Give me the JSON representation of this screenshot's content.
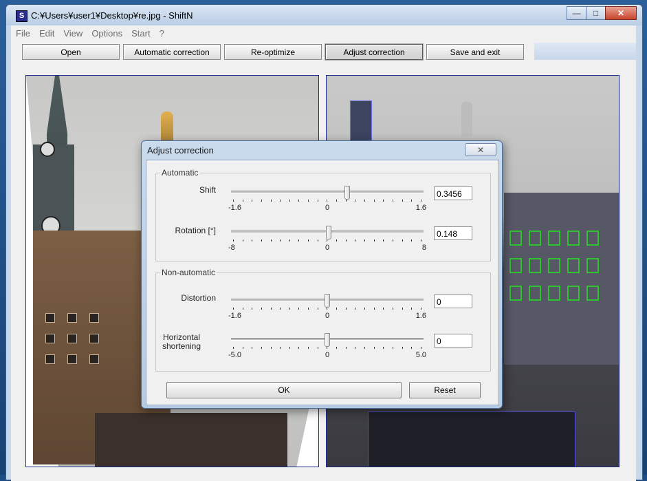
{
  "window": {
    "title": "C:¥Users¥user1¥Desktop¥re.jpg - ShiftN",
    "app_icon_letter": "S",
    "caption_buttons": {
      "minimize": "—",
      "maximize": "□",
      "close": "✕"
    }
  },
  "menu": {
    "items": [
      "File",
      "Edit",
      "View",
      "Options",
      "Start",
      "?"
    ]
  },
  "toolbar": {
    "open_label": "Open",
    "auto_label": "Automatic correction",
    "reopt_label": "Re-optimize",
    "adjust_label": "Adjust correction",
    "save_label": "Save and exit"
  },
  "dialog": {
    "title": "Adjust correction",
    "close_glyph": "✕",
    "automatic_group": "Automatic",
    "non_automatic_group": "Non-automatic",
    "shift": {
      "label": "Shift",
      "min": "-1.6",
      "mid": "0",
      "max": "1.6",
      "value": "0.3456",
      "level": 0.608
    },
    "rotation": {
      "label": "Rotation [°]",
      "min": "-8",
      "mid": "0",
      "max": "8",
      "value": "0.148",
      "level": 0.509
    },
    "distortion": {
      "label": "Distortion",
      "min": "-1.6",
      "mid": "0",
      "max": "1.6",
      "value": "0",
      "level": 0.5
    },
    "horizontal": {
      "label_line1": "Horizontal",
      "label_line2": "shortening",
      "min": "-5.0",
      "mid": "0",
      "max": "5.0",
      "value": "0",
      "level": 0.5
    },
    "ok_label": "OK",
    "reset_label": "Reset"
  }
}
